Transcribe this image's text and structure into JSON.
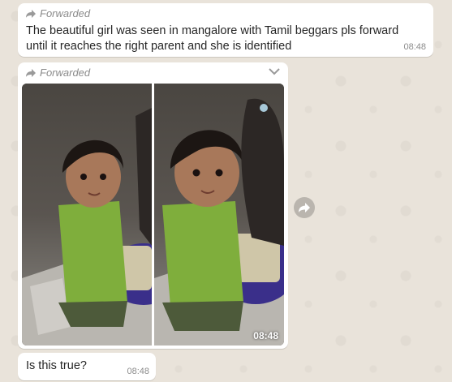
{
  "messages": [
    {
      "forwarded_label": "Forwarded",
      "text": "The beautiful girl was seen in mangalore with Tamil beggars pls forward until it reaches the right parent and she is identified",
      "time": "08:48"
    },
    {
      "forwarded_label": "Forwarded",
      "type": "image",
      "time": "08:48"
    },
    {
      "text": "Is this true?",
      "time": "08:48"
    }
  ],
  "icons": {
    "forwarded": "forward-arrow-icon",
    "menu": "chevron-down-icon",
    "share": "forward-share-icon"
  },
  "colors": {
    "wallpaper": "#e9e3da",
    "bubble": "#ffffff",
    "meta_text": "#8b8b8b"
  }
}
